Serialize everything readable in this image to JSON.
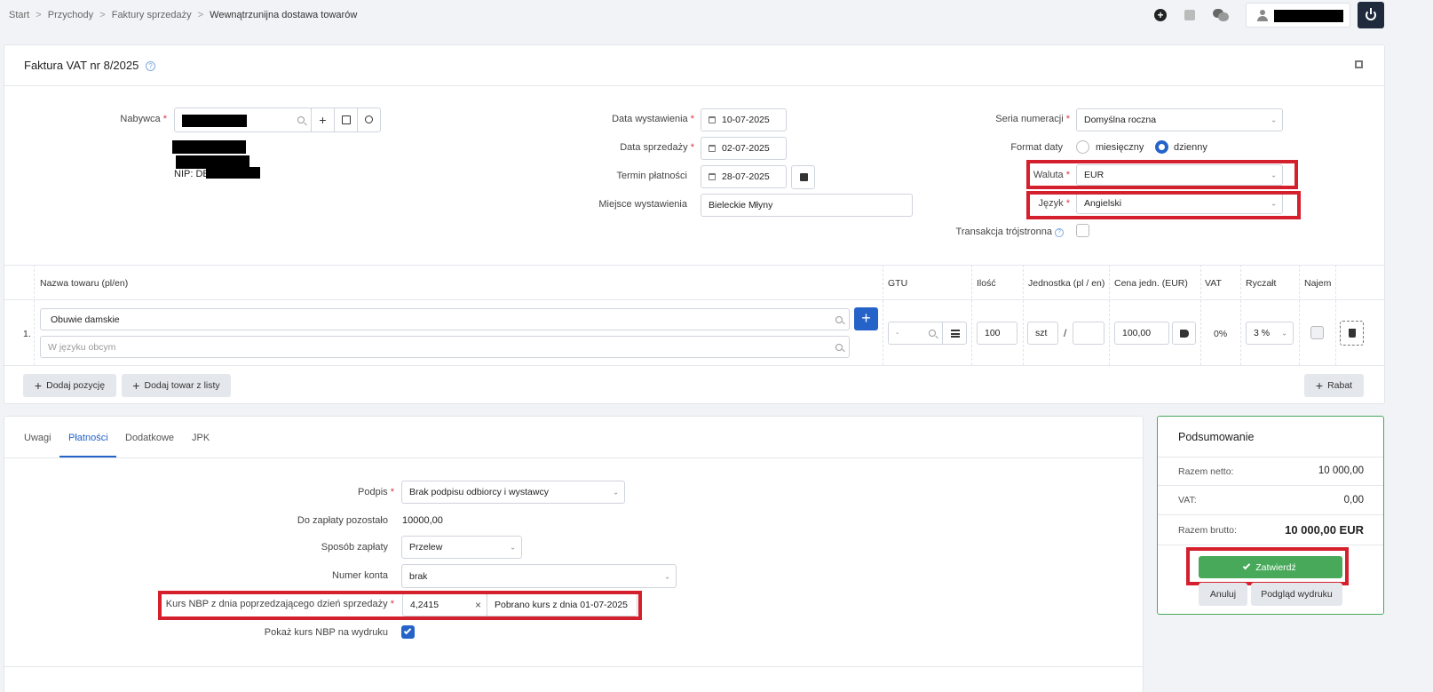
{
  "breadcrumb": {
    "items": [
      "Start",
      "Przychody",
      "Faktury sprzedaży",
      "Wewnątrzunijna dostawa towarów"
    ]
  },
  "invoice": {
    "title": "Faktura VAT nr 8/2025"
  },
  "buyer": {
    "label": "Nabywca",
    "nip_prefix": "NIP: DE"
  },
  "dates": {
    "issue_label": "Data wystawienia",
    "issue_value": "10-07-2025",
    "sale_label": "Data sprzedaży",
    "sale_value": "02-07-2025",
    "due_label": "Termin płatności",
    "due_value": "28-07-2025",
    "place_label": "Miejsce wystawienia",
    "place_value": "Bieleckie Młyny"
  },
  "settings": {
    "series_label": "Seria numeracji",
    "series_value": "Domyślna roczna",
    "date_format_label": "Format daty",
    "date_format_options": [
      "miesięczny",
      "dzienny"
    ],
    "currency_label": "Waluta",
    "currency_value": "EUR",
    "language_label": "Język",
    "language_value": "Angielski",
    "triangular_label": "Transakcja trójstronna"
  },
  "items_table": {
    "headers": [
      "Nazwa towaru (pl/en)",
      "GTU",
      "Ilość",
      "Jednostka (pl / en)",
      "Cena jedn. (EUR)",
      "VAT",
      "Ryczałt",
      "Najem"
    ],
    "row": {
      "index": "1.",
      "name": "Obuwie damskie",
      "foreign_placeholder": "W języku obcym",
      "gtu": "-",
      "quantity": "100",
      "unit": "szt",
      "unit_sep": "/",
      "price": "100,00",
      "vat": "0%",
      "lump_sum": "3 %"
    }
  },
  "item_actions": {
    "add_position": "Dodaj pozycję",
    "add_from_list": "Dodaj towar z listy",
    "discount": "Rabat"
  },
  "tabs": [
    "Uwagi",
    "Płatności",
    "Dodatkowe",
    "JPK"
  ],
  "payments": {
    "signature_label": "Podpis",
    "signature_value": "Brak podpisu odbiorcy i wystawcy",
    "remaining_label": "Do zapłaty pozostało",
    "remaining_value": "10000,00",
    "method_label": "Sposób zapłaty",
    "method_value": "Przelew",
    "account_label": "Numer konta",
    "account_value": "brak",
    "nbp_label": "Kurs NBP z dnia poprzedzającego dzień sprzedaży",
    "nbp_value": "4,2415",
    "nbp_info": "Pobrano kurs z dnia 01-07-2025",
    "show_nbp_label": "Pokaż kurs NBP na wydruku"
  },
  "summary": {
    "title": "Podsumowanie",
    "net_label": "Razem netto:",
    "net_value": "10 000,00",
    "vat_label": "VAT:",
    "vat_value": "0,00",
    "gross_label": "Razem brutto:",
    "gross_value": "10 000,00 EUR",
    "confirm": "Zatwierdź",
    "cancel": "Anuluj",
    "preview": "Podgląd wydruku"
  },
  "colors": {
    "primary": "#2563c9",
    "success": "#48a95a",
    "highlight": "#d41f2d",
    "dark": "#1f2b3d"
  }
}
